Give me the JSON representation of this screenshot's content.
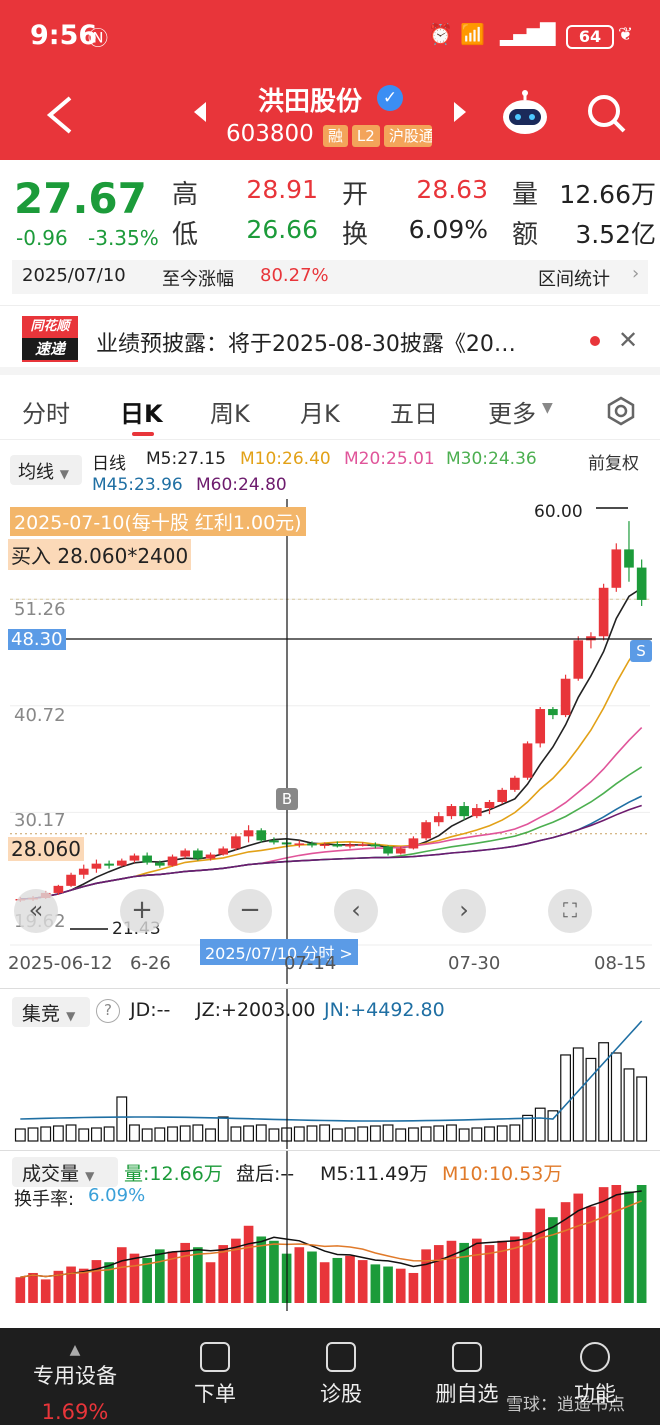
{
  "status": {
    "time": "9:56",
    "battery": "64"
  },
  "header": {
    "name": "洪田股份",
    "code": "603800",
    "tags": [
      "融",
      "L2",
      "沪股通"
    ]
  },
  "quote": {
    "price": "27.67",
    "change": "-0.96",
    "change_pct": "-3.35%",
    "high_label": "高",
    "high": "28.91",
    "open_label": "开",
    "open": "28.63",
    "vol_label": "量",
    "vol": "12.66万",
    "low_label": "低",
    "low": "26.66",
    "turnover_label": "换",
    "turnover": "6.09%",
    "amount_label": "额",
    "amount": "3.52亿"
  },
  "range": {
    "date": "2025/07/10",
    "label": "至今涨幅",
    "pct": "80.27%",
    "stat": "区间统计"
  },
  "news": {
    "logo_top": "同花顺",
    "logo_bottom": "速递",
    "text": "业绩预披露：将于2025-08-30披露《20…"
  },
  "tabs": [
    "分时",
    "日K",
    "周K",
    "月K",
    "五日",
    "更多"
  ],
  "ma": {
    "selector": "均线",
    "type": "日线",
    "m5": "M5:27.15",
    "m10": "M10:26.40",
    "m20": "M20:25.01",
    "m30": "M30:24.36",
    "m45": "M45:23.96",
    "m60": "M60:24.80",
    "fq": "前复权"
  },
  "chart": {
    "dividend_note": "2025-07-10(每十股 红利1.00元)",
    "buy_note": "买入 28.060*2400",
    "y_labels": [
      "51.26",
      "40.72",
      "30.17",
      "19.62"
    ],
    "cross_price": "48.30",
    "buy_price": "28.060",
    "max_label": "60.00",
    "min_label": "21.43",
    "x_labels": [
      "2025-06-12",
      "6-26",
      "07-14",
      "07-30",
      "08-15"
    ],
    "cursor_label": "2025/07/10  分时 >",
    "marker_b": "B",
    "marker_s": "S"
  },
  "chart_data": {
    "type": "candlestick",
    "candles": [
      [
        21.5,
        21.8,
        21.3,
        21.6
      ],
      [
        21.6,
        21.9,
        21.4,
        21.7
      ],
      [
        21.7,
        22.4,
        21.6,
        22.2
      ],
      [
        22.2,
        23.0,
        22.0,
        22.9
      ],
      [
        22.9,
        24.2,
        22.8,
        24.0
      ],
      [
        24.0,
        25.0,
        23.6,
        24.6
      ],
      [
        24.6,
        25.5,
        24.2,
        25.1
      ],
      [
        25.1,
        25.4,
        24.6,
        24.9
      ],
      [
        24.9,
        25.6,
        24.8,
        25.4
      ],
      [
        25.4,
        26.1,
        25.2,
        25.9
      ],
      [
        25.9,
        26.2,
        25.0,
        25.2
      ],
      [
        25.2,
        25.4,
        24.7,
        24.9
      ],
      [
        24.9,
        26.0,
        24.8,
        25.8
      ],
      [
        25.8,
        26.6,
        25.6,
        26.4
      ],
      [
        26.4,
        26.6,
        25.4,
        25.6
      ],
      [
        25.6,
        26.2,
        25.4,
        26.0
      ],
      [
        26.0,
        26.8,
        25.9,
        26.6
      ],
      [
        26.6,
        28.0,
        26.4,
        27.8
      ],
      [
        27.8,
        28.9,
        27.2,
        28.4
      ],
      [
        28.4,
        28.6,
        27.2,
        27.4
      ],
      [
        27.4,
        27.7,
        27.0,
        27.2
      ],
      [
        27.2,
        27.5,
        26.7,
        27.0
      ],
      [
        27.0,
        27.4,
        26.7,
        27.1
      ],
      [
        27.1,
        27.3,
        26.7,
        26.9
      ],
      [
        26.9,
        27.2,
        26.6,
        27.0
      ],
      [
        27.0,
        27.3,
        26.7,
        26.8
      ],
      [
        26.8,
        27.2,
        26.6,
        27.0
      ],
      [
        27.0,
        27.2,
        26.8,
        27.0
      ],
      [
        27.0,
        27.2,
        26.6,
        26.8
      ],
      [
        26.8,
        26.9,
        25.9,
        26.1
      ],
      [
        26.1,
        26.8,
        26.0,
        26.6
      ],
      [
        26.6,
        27.8,
        26.5,
        27.6
      ],
      [
        27.6,
        29.4,
        27.4,
        29.2
      ],
      [
        29.2,
        30.2,
        28.8,
        29.8
      ],
      [
        29.8,
        31.0,
        29.5,
        30.8
      ],
      [
        30.8,
        31.2,
        29.4,
        29.8
      ],
      [
        29.8,
        31.0,
        29.6,
        30.6
      ],
      [
        30.6,
        31.4,
        30.0,
        31.2
      ],
      [
        31.2,
        32.6,
        31.0,
        32.4
      ],
      [
        32.4,
        33.8,
        32.2,
        33.6
      ],
      [
        33.6,
        37.2,
        33.4,
        37.0
      ],
      [
        37.0,
        40.6,
        36.6,
        40.4
      ],
      [
        40.4,
        40.6,
        39.4,
        39.8
      ],
      [
        39.8,
        43.8,
        39.6,
        43.4
      ],
      [
        43.4,
        47.6,
        43.2,
        47.2
      ],
      [
        47.2,
        48.0,
        46.4,
        47.6
      ],
      [
        47.6,
        52.8,
        47.2,
        52.4
      ],
      [
        52.4,
        56.8,
        52.0,
        56.2
      ],
      [
        56.2,
        59.0,
        53.0,
        54.4
      ],
      [
        54.4,
        55.2,
        50.6,
        51.2
      ]
    ],
    "volume": [
      12,
      14,
      11,
      15,
      17,
      16,
      20,
      19,
      26,
      23,
      21,
      25,
      24,
      28,
      26,
      19,
      27,
      30,
      36,
      31,
      29,
      23,
      26,
      24,
      19,
      21,
      22,
      20,
      18,
      17,
      16,
      14,
      25,
      27,
      29,
      28,
      30,
      27,
      29,
      31,
      33,
      44,
      40,
      47,
      51,
      45,
      54,
      55,
      52,
      55
    ],
    "lights": {
      "ylabels_left": true
    }
  },
  "panel1": {
    "name": "集竞",
    "jd": "JD:-- ",
    "jz": "JZ:+2003.00",
    "jn": "JN:+4492.80"
  },
  "panel2": {
    "name": "成交量",
    "vol": "量:12.66万",
    "after": "盘后:--",
    "m5": "M5:11.49万",
    "m10": "M10:10.53万",
    "turnover_label": "换手率:",
    "turnover": "6.09%"
  },
  "bottom": {
    "device": "专用设备",
    "device_pct": "1.69%",
    "items": [
      "下单",
      "诊股",
      "删自选",
      "功能"
    ],
    "watermark": "雪球：逍遥书点"
  },
  "colors": {
    "up": "#e8353a",
    "down": "#1c9b3a",
    "m5": "#222222",
    "m10": "#e2a117",
    "m20": "#e0559a",
    "m30": "#4caf50",
    "m45": "#1f6fa3",
    "m60": "#6d1b6d"
  }
}
